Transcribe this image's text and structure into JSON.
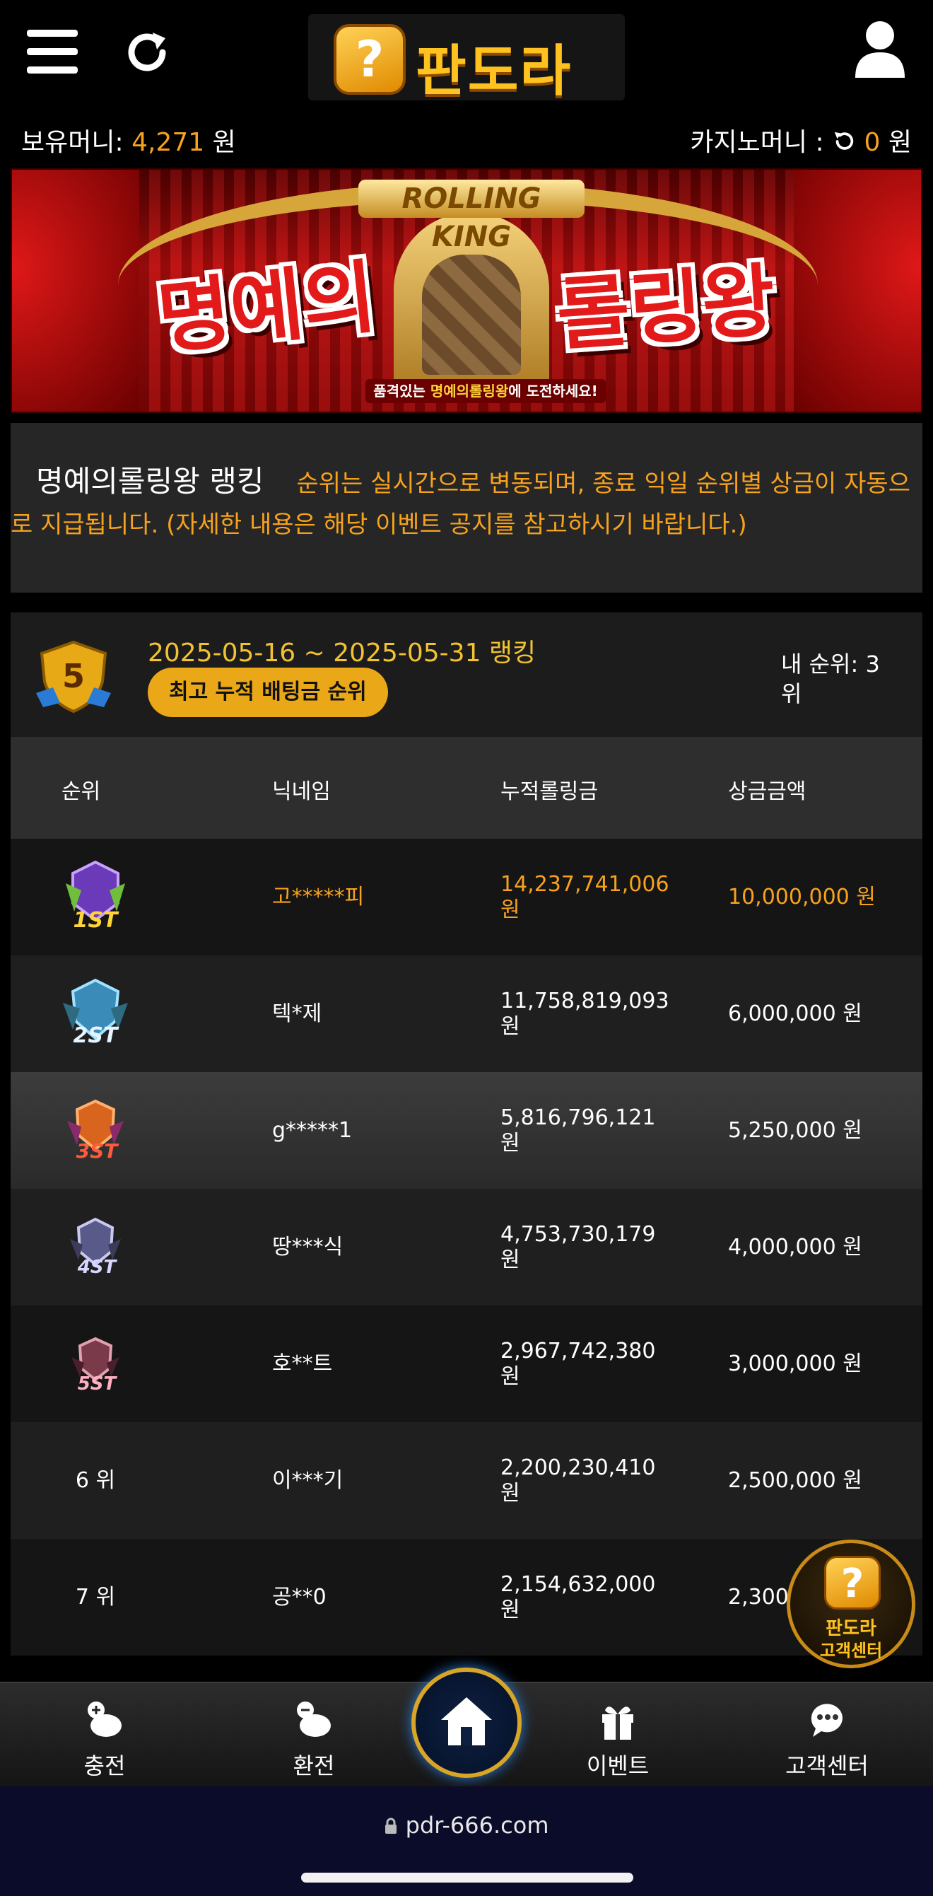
{
  "header": {
    "logo_text": "판도라",
    "logo_glyph": "?",
    "menu_icon": "hamburger-menu-icon",
    "refresh_icon": "refresh-icon",
    "user_icon": "user-icon"
  },
  "balance": {
    "money_label": "보유머니:",
    "money_value": "4,271",
    "money_unit": "원",
    "casino_label": "카지노머니 :",
    "casino_value": "0",
    "casino_unit": "원"
  },
  "banner": {
    "rolling_king": "ROLLING KING",
    "title_left": "명예의",
    "title_right": "롤링왕",
    "sub_prefix": "품격있는 ",
    "sub_highlight": "명예의롤링왕",
    "sub_suffix": "에 도전하세요!"
  },
  "notice": {
    "title": "명예의롤링왕 랭킹",
    "body": "순위는 실시간으로 변동되며, 종료 익일 순위별 상금이 자동으로 지급됩니다. (자세한 내용은 해당 이벤트 공지를 참고하시기 바랍니다.)"
  },
  "ranking": {
    "badge_number": "5",
    "date_range": "2025-05-16 ~ 2025-05-31 랭킹",
    "pill_label": "최고 누적 배팅금 순위",
    "my_rank": "내 순위: 3 위"
  },
  "table": {
    "headers": [
      "순위",
      "닉네임",
      "누적롤링금",
      "상금금액"
    ],
    "rows": [
      {
        "rank": "1ST",
        "nickname": "고*****피",
        "rolling": "14,237,741,006 원",
        "prize": "10,000,000 원"
      },
      {
        "rank": "2ST",
        "nickname": "텍*제",
        "rolling": "11,758,819,093 원",
        "prize": "6,000,000 원"
      },
      {
        "rank": "3ST",
        "nickname": "g*****1",
        "rolling": "5,816,796,121 원",
        "prize": "5,250,000 원"
      },
      {
        "rank": "4ST",
        "nickname": "땅***식",
        "rolling": "4,753,730,179 원",
        "prize": "4,000,000 원"
      },
      {
        "rank": "5ST",
        "nickname": "호**트",
        "rolling": "2,967,742,380 원",
        "prize": "3,000,000 원"
      },
      {
        "rank": "6 위",
        "nickname": "이***기",
        "rolling": "2,200,230,410 원",
        "prize": "2,500,000 원"
      },
      {
        "rank": "7 위",
        "nickname": "공**0",
        "rolling": "2,154,632,000 원",
        "prize": "2,300,000 원"
      }
    ]
  },
  "float_cs": {
    "glyph": "?",
    "line1": "판도라",
    "line2": "고객센터"
  },
  "bottom_nav": {
    "items": [
      {
        "label": "충전",
        "icon": "deposit-piggy-icon"
      },
      {
        "label": "환전",
        "icon": "withdraw-piggy-icon"
      },
      {
        "label": "",
        "icon": "home-icon"
      },
      {
        "label": "이벤트",
        "icon": "gift-icon"
      },
      {
        "label": "고객센터",
        "icon": "chat-support-icon"
      }
    ]
  },
  "browser": {
    "url": "pdr-666.com"
  },
  "colors": {
    "accent": "#f7a21e",
    "gold": "#eaa818",
    "background": "#000000"
  }
}
